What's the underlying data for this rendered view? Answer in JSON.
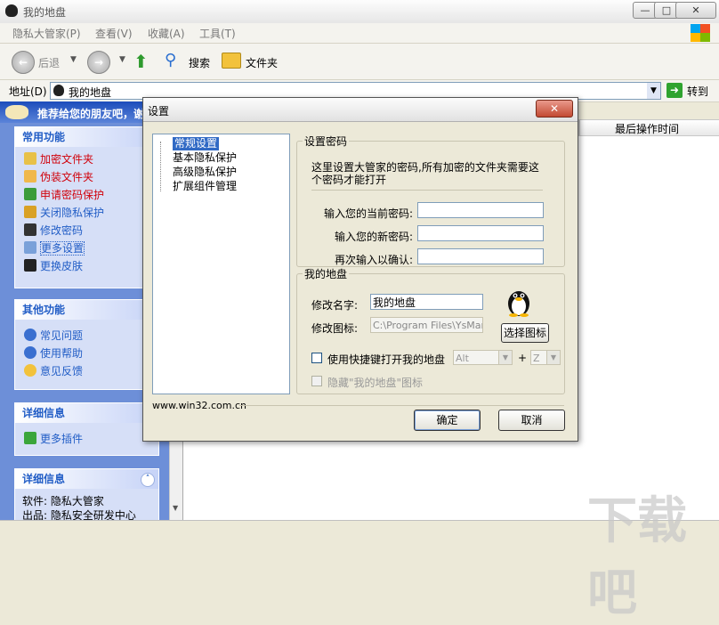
{
  "window": {
    "title": "我的地盘",
    "min_label": "—",
    "max_label": "□",
    "close_label": "✕"
  },
  "menu": [
    "隐私大管家(P)",
    "查看(V)",
    "收藏(A)",
    "工具(T)"
  ],
  "toolbar": {
    "back_label": "后退",
    "search_label": "搜索",
    "folders_label": "文件夹"
  },
  "address": {
    "label": "地址(D)",
    "value": "我的地盘",
    "go_label": "转到"
  },
  "left": {
    "banner": "推荐给您的朋友吧，谢",
    "common": {
      "title": "常用功能",
      "items": [
        "加密文件夹",
        "伪装文件夹",
        "申请密码保护",
        "关闭隐私保护",
        "修改密码",
        "更多设置",
        "更换皮肤"
      ]
    },
    "other": {
      "title": "其他功能",
      "items": [
        "常见问题",
        "使用帮助",
        "意见反馈"
      ]
    },
    "detail1": {
      "title": "详细信息",
      "items": [
        "更多插件"
      ]
    },
    "detail2": {
      "title": "详细信息",
      "line1": "软件: 隐私大管家",
      "line2": "出品: 隐私安全研发中心"
    }
  },
  "list": {
    "column_last_op": "最后操作时间"
  },
  "dialog": {
    "title": "设置",
    "close_label": "✕",
    "tree": [
      "常规设置",
      "基本隐私保护",
      "高级隐私保护",
      "扩展组件管理"
    ],
    "password": {
      "legend": "设置密码",
      "desc_line1": "这里设置大管家的密码,所有加密的文件夹需要这",
      "desc_line2": "个密码才能打开",
      "current_label": "输入您的当前密码:",
      "new_label": "输入您的新密码:",
      "confirm_label": "再次输入以确认:"
    },
    "mydisk": {
      "legend": "我的地盘",
      "name_label": "修改名字:",
      "name_value": "我的地盘",
      "icon_label": "修改图标:",
      "icon_value": "C:\\Program Files\\YsMana",
      "choose_icon_label": "选择图标",
      "hotkey_label": "使用快捷键打开我的地盘",
      "hotkey_mod": "Alt",
      "hotkey_plus": "+",
      "hotkey_key": "Z",
      "hide_label": "隐藏\"我的地盘\"图标"
    },
    "website": "www.win32.com.cn",
    "ok_label": "确定",
    "cancel_label": "取消"
  },
  "watermark": "下载吧",
  "colors": {
    "link_blue": "#215dc6",
    "link_red": "#d1000a",
    "panel_bg": "#6d8fd8",
    "section_bg": "#d6dff7"
  }
}
